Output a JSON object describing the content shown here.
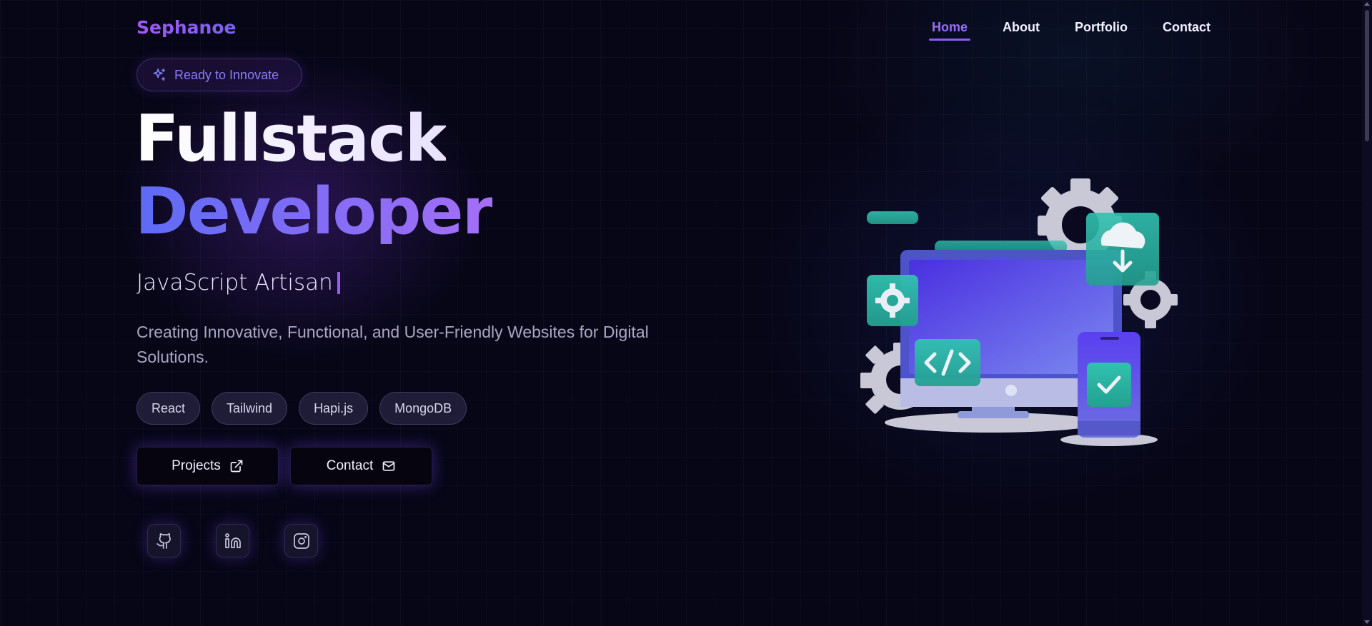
{
  "brand": {
    "name": "Sephanoe"
  },
  "nav": [
    {
      "label": "Home",
      "active": true
    },
    {
      "label": "About",
      "active": false
    },
    {
      "label": "Portfolio",
      "active": false
    },
    {
      "label": "Contact",
      "active": false
    }
  ],
  "hero": {
    "badge": "Ready to Innovate",
    "title_line1": "Fullstack",
    "title_line2": "Developer",
    "role": "JavaScript Artisan",
    "description": "Creating Innovative, Functional, and User-Friendly Websites for Digital Solutions.",
    "tags": [
      "React",
      "Tailwind",
      "Hapi.js",
      "MongoDB"
    ],
    "buttons": {
      "projects": "Projects",
      "contact": "Contact"
    }
  },
  "socials": [
    {
      "icon": "github-icon"
    },
    {
      "icon": "linkedin-icon"
    },
    {
      "icon": "instagram-icon"
    }
  ],
  "colors": {
    "accent": "#8b5cf6",
    "background": "#07061a",
    "teal": "#2bb5a0"
  }
}
